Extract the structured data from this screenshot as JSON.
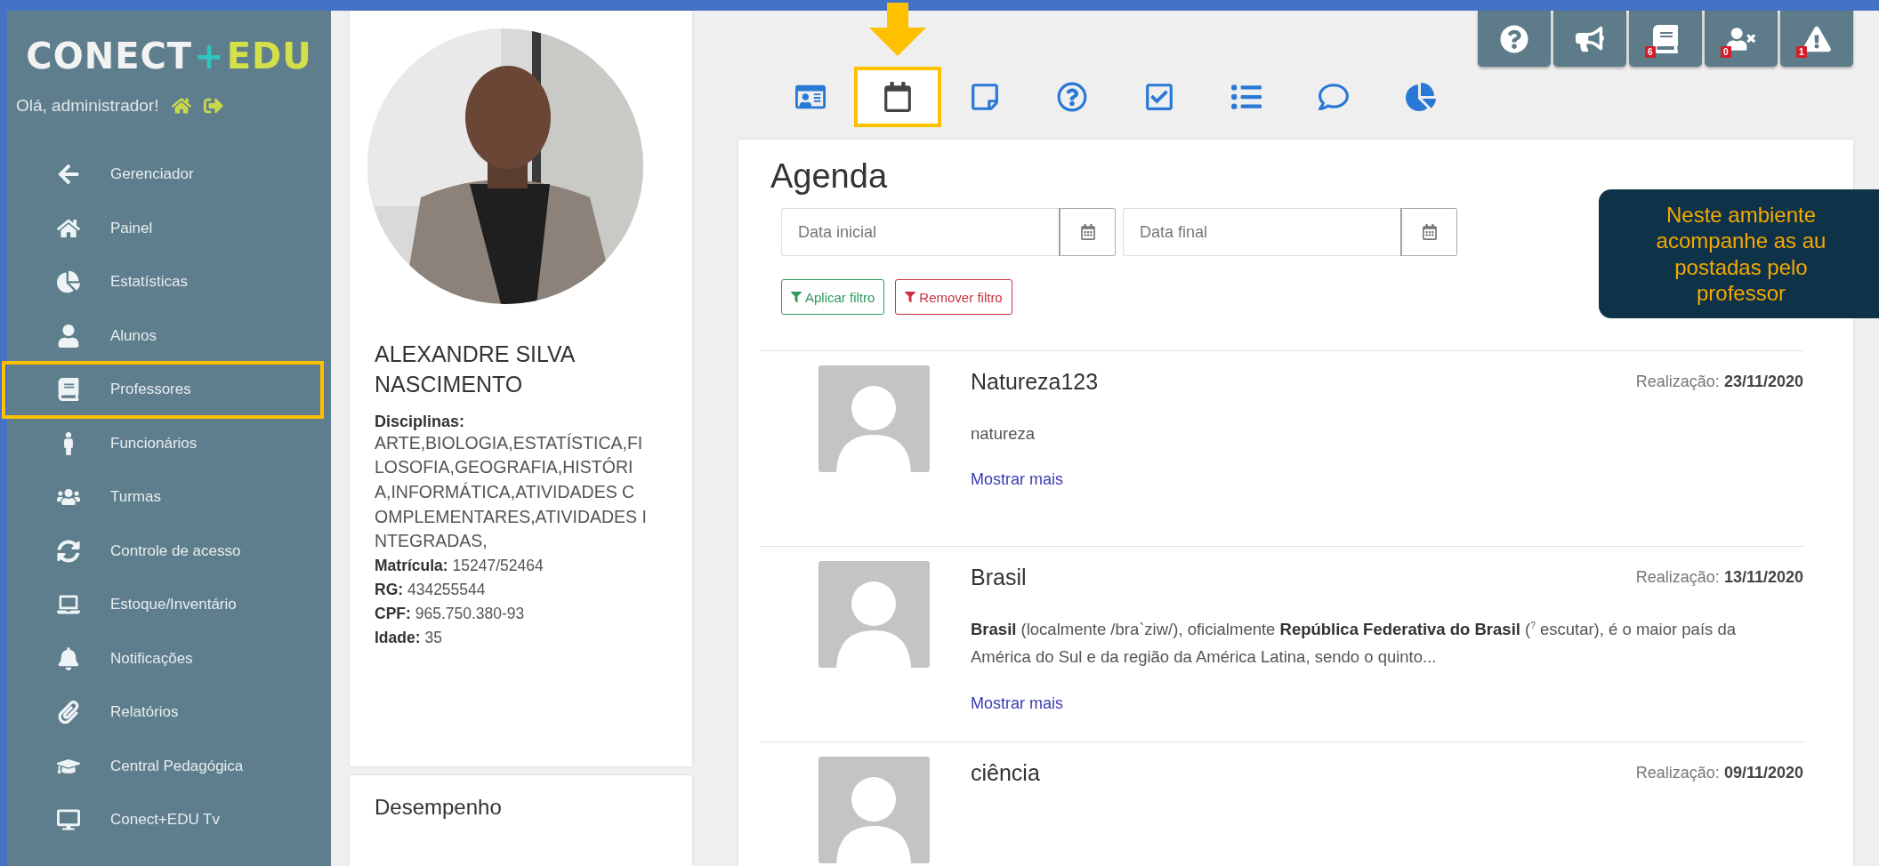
{
  "sidebar": {
    "logo": {
      "first": "CONECT",
      "plus": "+",
      "last": "EDU"
    },
    "greeting": "Olá, administrador!",
    "items": [
      {
        "kind": "back",
        "label": "Gerenciador",
        "highlighted": false
      },
      {
        "kind": "home",
        "label": "Painel",
        "highlighted": false
      },
      {
        "kind": "stats",
        "label": "Estatísticas",
        "highlighted": false
      },
      {
        "kind": "student",
        "label": "Alunos",
        "highlighted": false
      },
      {
        "kind": "teacher",
        "label": "Professores",
        "highlighted": true
      },
      {
        "kind": "staff",
        "label": "Funcionários",
        "highlighted": false
      },
      {
        "kind": "classes",
        "label": "Turmas",
        "highlighted": false
      },
      {
        "kind": "access",
        "label": "Controle de acesso",
        "highlighted": false
      },
      {
        "kind": "stock",
        "label": "Estoque/Inventário",
        "highlighted": false
      },
      {
        "kind": "notify",
        "label": "Notificações",
        "highlighted": false
      },
      {
        "kind": "report",
        "label": "Relatórios",
        "highlighted": false
      },
      {
        "kind": "pedagogy",
        "label": "Central Pedagógica",
        "highlighted": false
      },
      {
        "kind": "tv",
        "label": "Conect+EDU Tv",
        "highlighted": false
      }
    ]
  },
  "profile": {
    "photo": {
      "kind": "picture"
    },
    "name": "ALEXANDRE SILVA NASCIMENTO",
    "subjects_label": "Disciplinas:",
    "subjects": "ARTE,BIOLOGIA,ESTATÍSTICA,FILOSOFIA,GEOGRAFIA,HISTÓRIA,INFORMÁTICA,ATIVIDADES COMPLEMENTARES,ATIVIDADES INTEGRADAS,",
    "details": [
      "**Matrícula:** 15247/52464",
      "**RG:** 434255544",
      "**CPF:** 965.750.380-93",
      "**Idade:** 35"
    ],
    "performance_title": "Desempenho"
  },
  "top_buttons": [
    {
      "kind": "help"
    },
    {
      "kind": "announce"
    },
    {
      "kind": "book",
      "badge": "6"
    },
    {
      "kind": "absent",
      "badge": "0"
    },
    {
      "kind": "alert",
      "badge": "1"
    }
  ],
  "tabs": [
    {
      "kind": "profile",
      "selected": false,
      "highlighted": false
    },
    {
      "kind": "agenda",
      "selected": true,
      "highlighted": true
    },
    {
      "kind": "notes",
      "selected": false,
      "highlighted": false
    },
    {
      "kind": "questions",
      "selected": false,
      "highlighted": false
    },
    {
      "kind": "tasks",
      "selected": false,
      "highlighted": false
    },
    {
      "kind": "list",
      "selected": false,
      "highlighted": false
    },
    {
      "kind": "chat",
      "selected": false,
      "highlighted": false
    },
    {
      "kind": "chart",
      "selected": false,
      "highlighted": false
    }
  ],
  "agenda": {
    "title": "Agenda",
    "start_placeholder": "Data inicial",
    "end_placeholder": "Data final",
    "filters": [
      {
        "kind": "apply",
        "label": "Aplicar filtro"
      },
      {
        "kind": "remove",
        "label": "Remover filtro"
      }
    ],
    "entries": [
      {
        "title": "Natureza123",
        "date_label": "Realização:",
        "date": "23/11/2020",
        "body": "natureza",
        "link": "Mostrar mais"
      },
      {
        "title": "Brasil",
        "date_label": "Realização:",
        "date": "13/11/2020",
        "body": "**Brasil** (localmente /bra`ziw/), oficialmente **República Federativa do Brasil** ($^{?}$ escutar), é o maior país da América do Sul e da região da América Latina, sendo o quinto...",
        "link": "Mostrar mais"
      },
      {
        "title": "ciência",
        "date_label": "Realização:",
        "date": "09/11/2020"
      }
    ]
  },
  "callout": {
    "lines": [
      "Neste ambiente",
      "acompanhe as au",
      "postadas pelo",
      "professor"
    ]
  }
}
